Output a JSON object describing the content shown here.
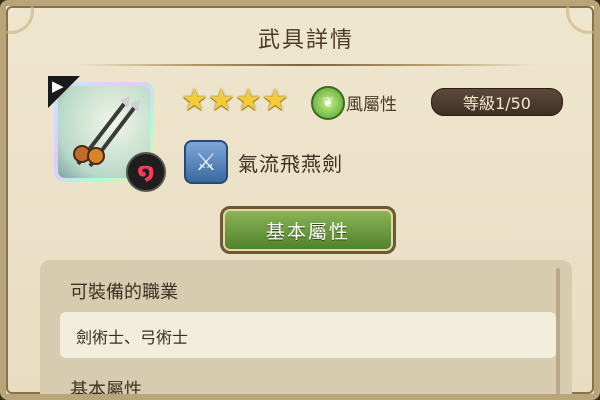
{
  "header": {
    "title": "武具詳情"
  },
  "weapon": {
    "type_icon": "play-triangle-icon",
    "rune_icon": "swirl-rune-icon"
  },
  "rating": {
    "stars": 4,
    "icon": "star-icon"
  },
  "attribute": {
    "label": "風屬性",
    "icon": "wind-leaf-icon",
    "color": "#4f9f2a"
  },
  "level": {
    "label": "等級1/50"
  },
  "skill": {
    "name": "氣流飛燕劍",
    "icon": "crossed-swords-icon"
  },
  "tab": {
    "label": "基本屬性"
  },
  "section": {
    "equip_header": "可裝備的職業",
    "equip_value": "劍術士、弓術士",
    "stats_header": "基本屬性"
  },
  "colors": {
    "star": "#f4cc3a",
    "panel": "#efe6cf",
    "level_pill": "#4a3a2c",
    "button": "#6c9a3f"
  }
}
